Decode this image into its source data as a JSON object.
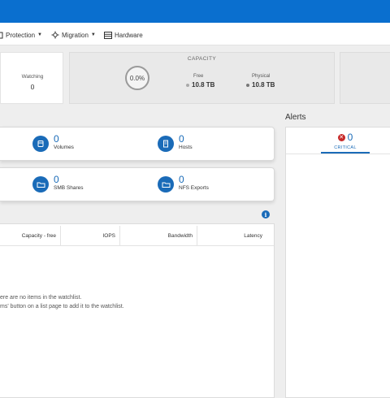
{
  "menu": {
    "protection": "Protection",
    "migration": "Migration",
    "hardware": "Hardware"
  },
  "summary": {
    "watching_label": "Watching",
    "watching_value": "0",
    "capacity_title": "CAPACITY",
    "percent_used": "0.0%",
    "free_label": "Free",
    "free_value": "10.8 TB",
    "physical_label": "Physical",
    "physical_value": "10.8 TB"
  },
  "objects": {
    "volumes": {
      "count": "0",
      "label": "Volumes"
    },
    "hosts": {
      "count": "0",
      "label": "Hosts"
    },
    "smb_shares": {
      "count": "0",
      "label": "SMB Shares"
    },
    "nfs_exports": {
      "count": "0",
      "label": "NFS Exports"
    }
  },
  "watchlist": {
    "columns": [
      "Capacity - free",
      "IOPS",
      "Bandwidth",
      "Latency"
    ],
    "empty_line1": "ere are no items in the watchlist.",
    "empty_line2": "ms' button on a list page to add it to the watchlist."
  },
  "alerts": {
    "title": "Alerts",
    "critical_count": "0",
    "critical_label": "CRITICAL"
  },
  "colors": {
    "brand_blue": "#0a6fcf",
    "accent_blue": "#1a6bb8",
    "critical_red": "#c62828"
  }
}
